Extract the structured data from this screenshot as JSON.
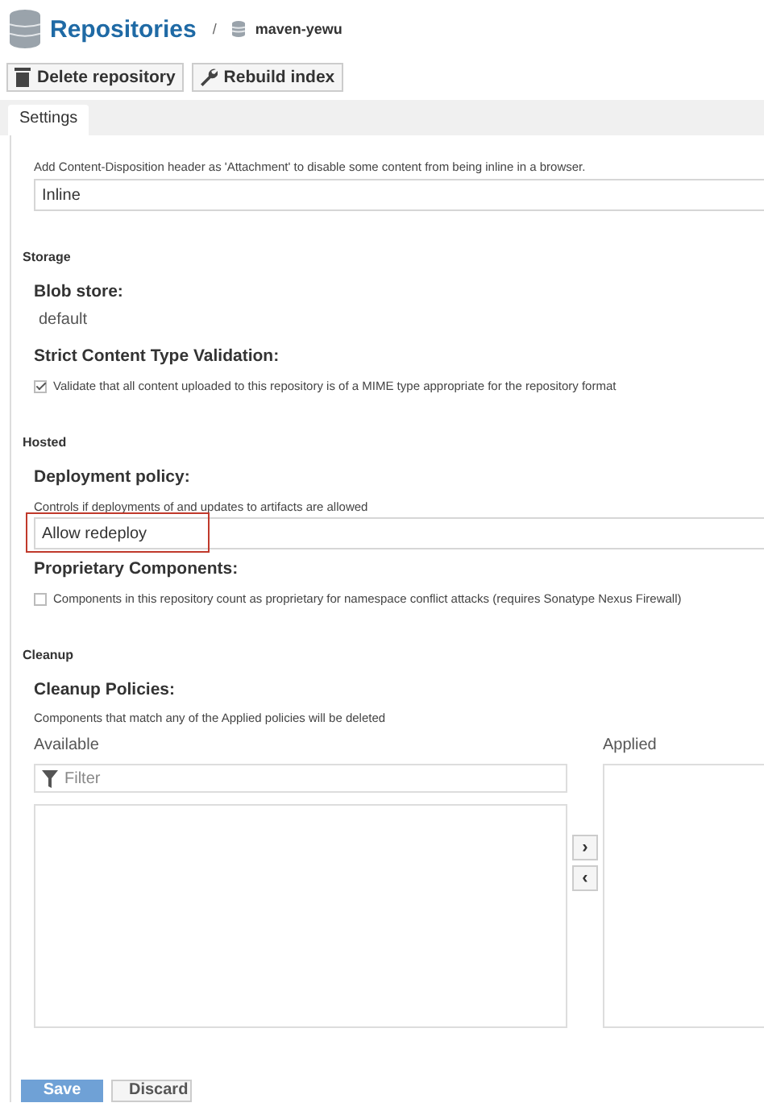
{
  "header": {
    "title": "Repositories",
    "separator": "/",
    "repository": "maven-yewu"
  },
  "toolbar": [
    {
      "label": "Delete repository",
      "kind": "delete"
    },
    {
      "label": "Rebuild index",
      "kind": "rebuild"
    }
  ],
  "tabs": [
    {
      "label": "Settings",
      "selected": true
    }
  ],
  "content_disposition": {
    "description": "Add Content-Disposition header as 'Attachment' to disable some content from being inline in a browser.",
    "value": "Inline"
  },
  "storage": {
    "heading": "Storage",
    "blob_store_label": "Blob store:",
    "blob_store": "default",
    "strict_label": "Strict Content Type Validation:",
    "strict_text": "Validate that all content uploaded to this repository is of a MIME type appropriate for the repository format",
    "strict_checked": true
  },
  "hosted": {
    "heading": "Hosted",
    "deployment_label": "Deployment policy:",
    "deployment_description": "Controls if deployments of and updates to artifacts are allowed",
    "deployment_value": "Allow redeploy",
    "deployment_highlighted": true,
    "proprietary_label": "Proprietary Components:",
    "proprietary_text": "Components in this repository count as proprietary for namespace conflict attacks (requires Sonatype Nexus Firewall)",
    "proprietary_checked": false
  },
  "cleanup": {
    "heading": "Cleanup",
    "label": "Cleanup Policies:",
    "description": "Components that match any of the Applied policies will be deleted",
    "available_label": "Available",
    "filter_placeholder": "Filter",
    "applied_label": "Applied",
    "move_buttons": [
      "›",
      "‹"
    ]
  },
  "buttons": [
    {
      "label": "Save",
      "kind": "primary"
    },
    {
      "label": "Discard",
      "kind": "secondary"
    }
  ]
}
